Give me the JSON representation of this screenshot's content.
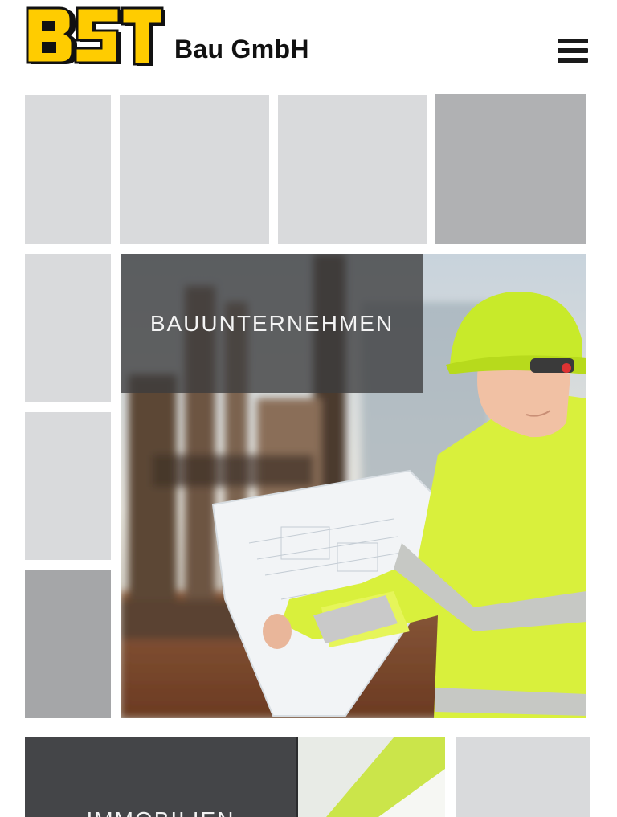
{
  "header": {
    "logo_text": "BST",
    "company_name": "Bau GmbH",
    "menu_icon": "hamburger-menu-icon"
  },
  "hero": {
    "label": "BAUUNTERNEHMEN"
  },
  "bottom_card": {
    "label": "IMMOBILIEN"
  },
  "colors": {
    "logo_yellow": "#ffcc00",
    "logo_black": "#111111",
    "tile_light": "#d9dadc",
    "tile_dark": "#b0b1b3",
    "hivis_yellow": "#d6f03a"
  }
}
